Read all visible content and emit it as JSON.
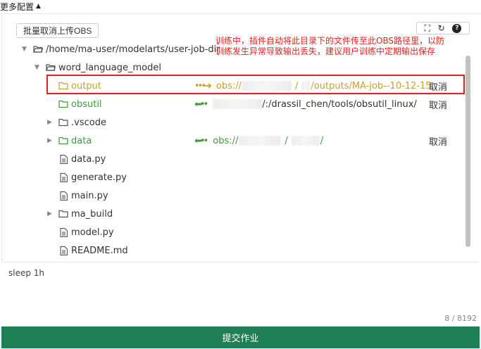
{
  "header": {
    "more_config": "更多配置"
  },
  "toolbar": {
    "batch_cancel": "批量取消上传OBS"
  },
  "tree": {
    "root": "/home/ma-user/modelarts/user-job-dir",
    "project": "word_language_model",
    "items": [
      {
        "name": "output",
        "mapping": "obs://…/…/…/outputs/MA-job--10-12-15…",
        "mapping_parts": [
          "obs://",
          "/",
          "/outputs/MA-job--10-12-15…"
        ],
        "action": "取消"
      },
      {
        "name": "obsutil",
        "mapping_parts": [
          "/:/drassil_chen/tools/obsutil_linux/"
        ],
        "action": "取消"
      },
      {
        "name": ".vscode"
      },
      {
        "name": "data",
        "mapping_parts": [
          "obs://",
          "/",
          "/"
        ],
        "action": "取消"
      },
      {
        "name": "data.py"
      },
      {
        "name": "generate.py"
      },
      {
        "name": "main.py"
      },
      {
        "name": "ma_build"
      },
      {
        "name": "model.py"
      },
      {
        "name": "README.md"
      }
    ]
  },
  "annotation": {
    "text": "训练中，插件自动将此目录下的文件传至此OBS路径里，以防训练发生异常导致输出丢失，建议用户训练中定期输出保存"
  },
  "editor": {
    "command": "sleep 1h",
    "counter": "8 / 8192"
  },
  "footer": {
    "submit_label": "提交作业"
  },
  "colors": {
    "submit": "#1e7f54",
    "output_folder": "#c8a02d",
    "synced_folder": "#3c9a3c",
    "annotation": "#e02020"
  }
}
